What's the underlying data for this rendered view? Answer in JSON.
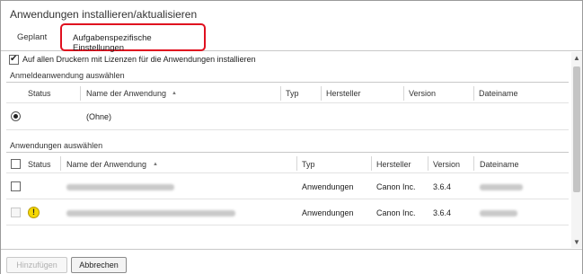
{
  "window": {
    "title": "Anwendungen installieren/aktualisieren"
  },
  "tabs": [
    {
      "label": "Geplant",
      "active": false
    },
    {
      "label": "Aufgabenspezifische Einstellungen",
      "active": true
    }
  ],
  "options": {
    "install_all_label": "Auf allen Druckern mit Lizenzen für die Anwendungen installieren",
    "install_all_checked": true
  },
  "login_section": {
    "title": "Anmeldeanwendung auswählen",
    "columns": [
      "Status",
      "Name der Anwendung",
      "Typ",
      "Hersteller",
      "Version",
      "Dateiname"
    ],
    "rows": [
      {
        "selected": true,
        "name": "(Ohne)",
        "type": "",
        "vendor": "",
        "version": "",
        "filename": ""
      }
    ]
  },
  "apps_section": {
    "title": "Anwendungen auswählen",
    "columns": [
      "Status",
      "Name der Anwendung",
      "Typ",
      "Hersteller",
      "Version",
      "Dateiname"
    ],
    "rows": [
      {
        "checked": false,
        "disabled": false,
        "warning": false,
        "name": "",
        "type": "Anwendungen",
        "vendor": "Canon Inc.",
        "version": "3.6.4",
        "filename": ""
      },
      {
        "checked": false,
        "disabled": true,
        "warning": true,
        "warning_glyph": "!",
        "name": "",
        "type": "Anwendungen",
        "vendor": "Canon Inc.",
        "version": "3.6.4",
        "filename": ""
      }
    ]
  },
  "icons": {
    "sort": "▲",
    "scroll_up": "▲",
    "scroll_down": "▼"
  },
  "footer": {
    "add_label": "Hinzufügen",
    "add_disabled": true,
    "cancel_label": "Abbrechen"
  }
}
